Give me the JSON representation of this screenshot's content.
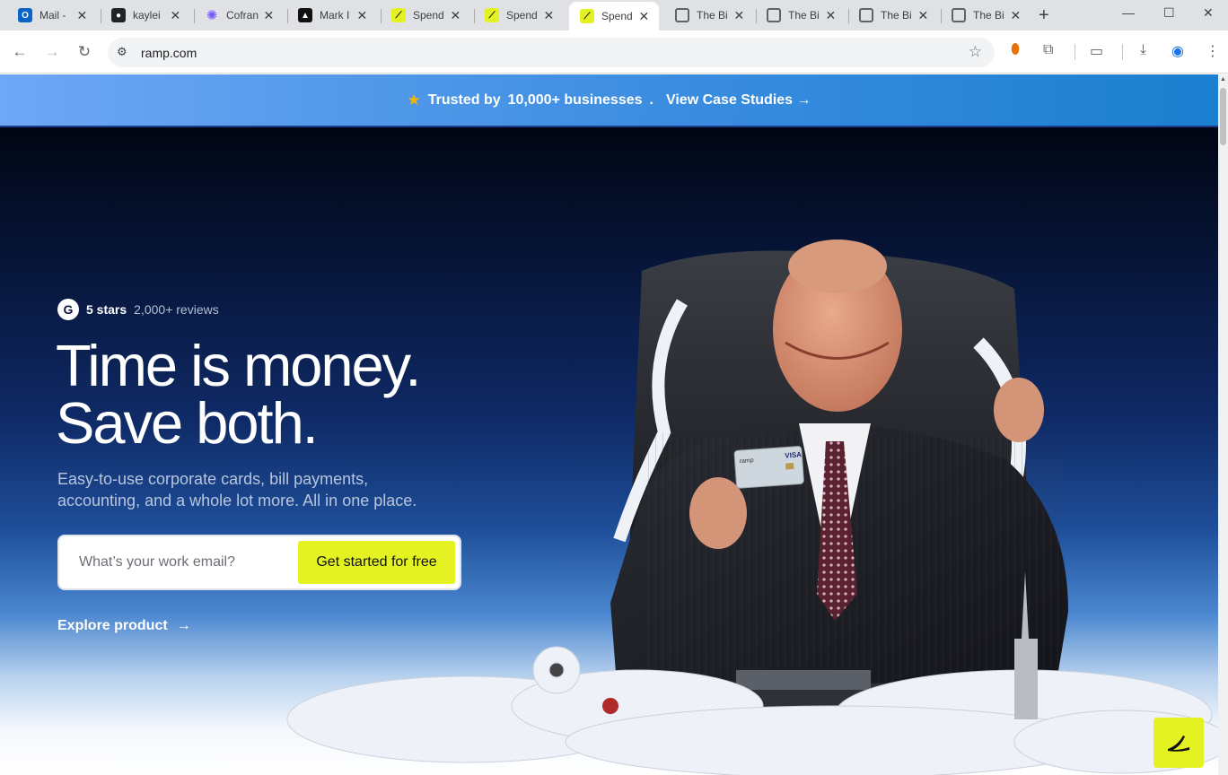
{
  "browser": {
    "tabs": [
      {
        "title": "Mail -",
        "icon": "outlook-icon",
        "active": false
      },
      {
        "title": "kaylei",
        "icon": "github-icon",
        "active": false
      },
      {
        "title": "Cofran",
        "icon": "cofran-icon",
        "active": false
      },
      {
        "title": "Mark I",
        "icon": "mark-icon",
        "active": false
      },
      {
        "title": "Spend",
        "icon": "ramp-icon",
        "active": false
      },
      {
        "title": "Spend",
        "icon": "ramp-icon",
        "active": false
      },
      {
        "title": "Spend",
        "icon": "ramp-icon",
        "active": true
      },
      {
        "title": "The Bi",
        "icon": "globe-icon",
        "active": false
      },
      {
        "title": "The Bi",
        "icon": "globe-icon",
        "active": false
      },
      {
        "title": "The Bi",
        "icon": "globe-icon",
        "active": false
      },
      {
        "title": "The Bi",
        "icon": "globe-icon",
        "active": false
      }
    ],
    "url": "ramp.com"
  },
  "banner": {
    "trusted_prefix": "Trusted by",
    "trusted_count": "10,000+ businesses",
    "separator": ".",
    "case_studies_link": "View Case Studies →"
  },
  "hero": {
    "rating_stars": "5 stars",
    "rating_count": "2,000+ reviews",
    "headline_line1": "Time is money.",
    "headline_line2": "Save both.",
    "subhead": "Easy-to-use corporate cards, bill payments, accounting, and a whole lot more. All in one place.",
    "email_placeholder": "What’s your work email?",
    "cta_label": "Get started for free",
    "explore_label": "Explore product",
    "card_brand": "ramp",
    "card_network": "VISA"
  },
  "colors": {
    "brand_yellow": "#e4f222",
    "banner_blue": "#3b8de0",
    "hero_dark": "#010614"
  }
}
